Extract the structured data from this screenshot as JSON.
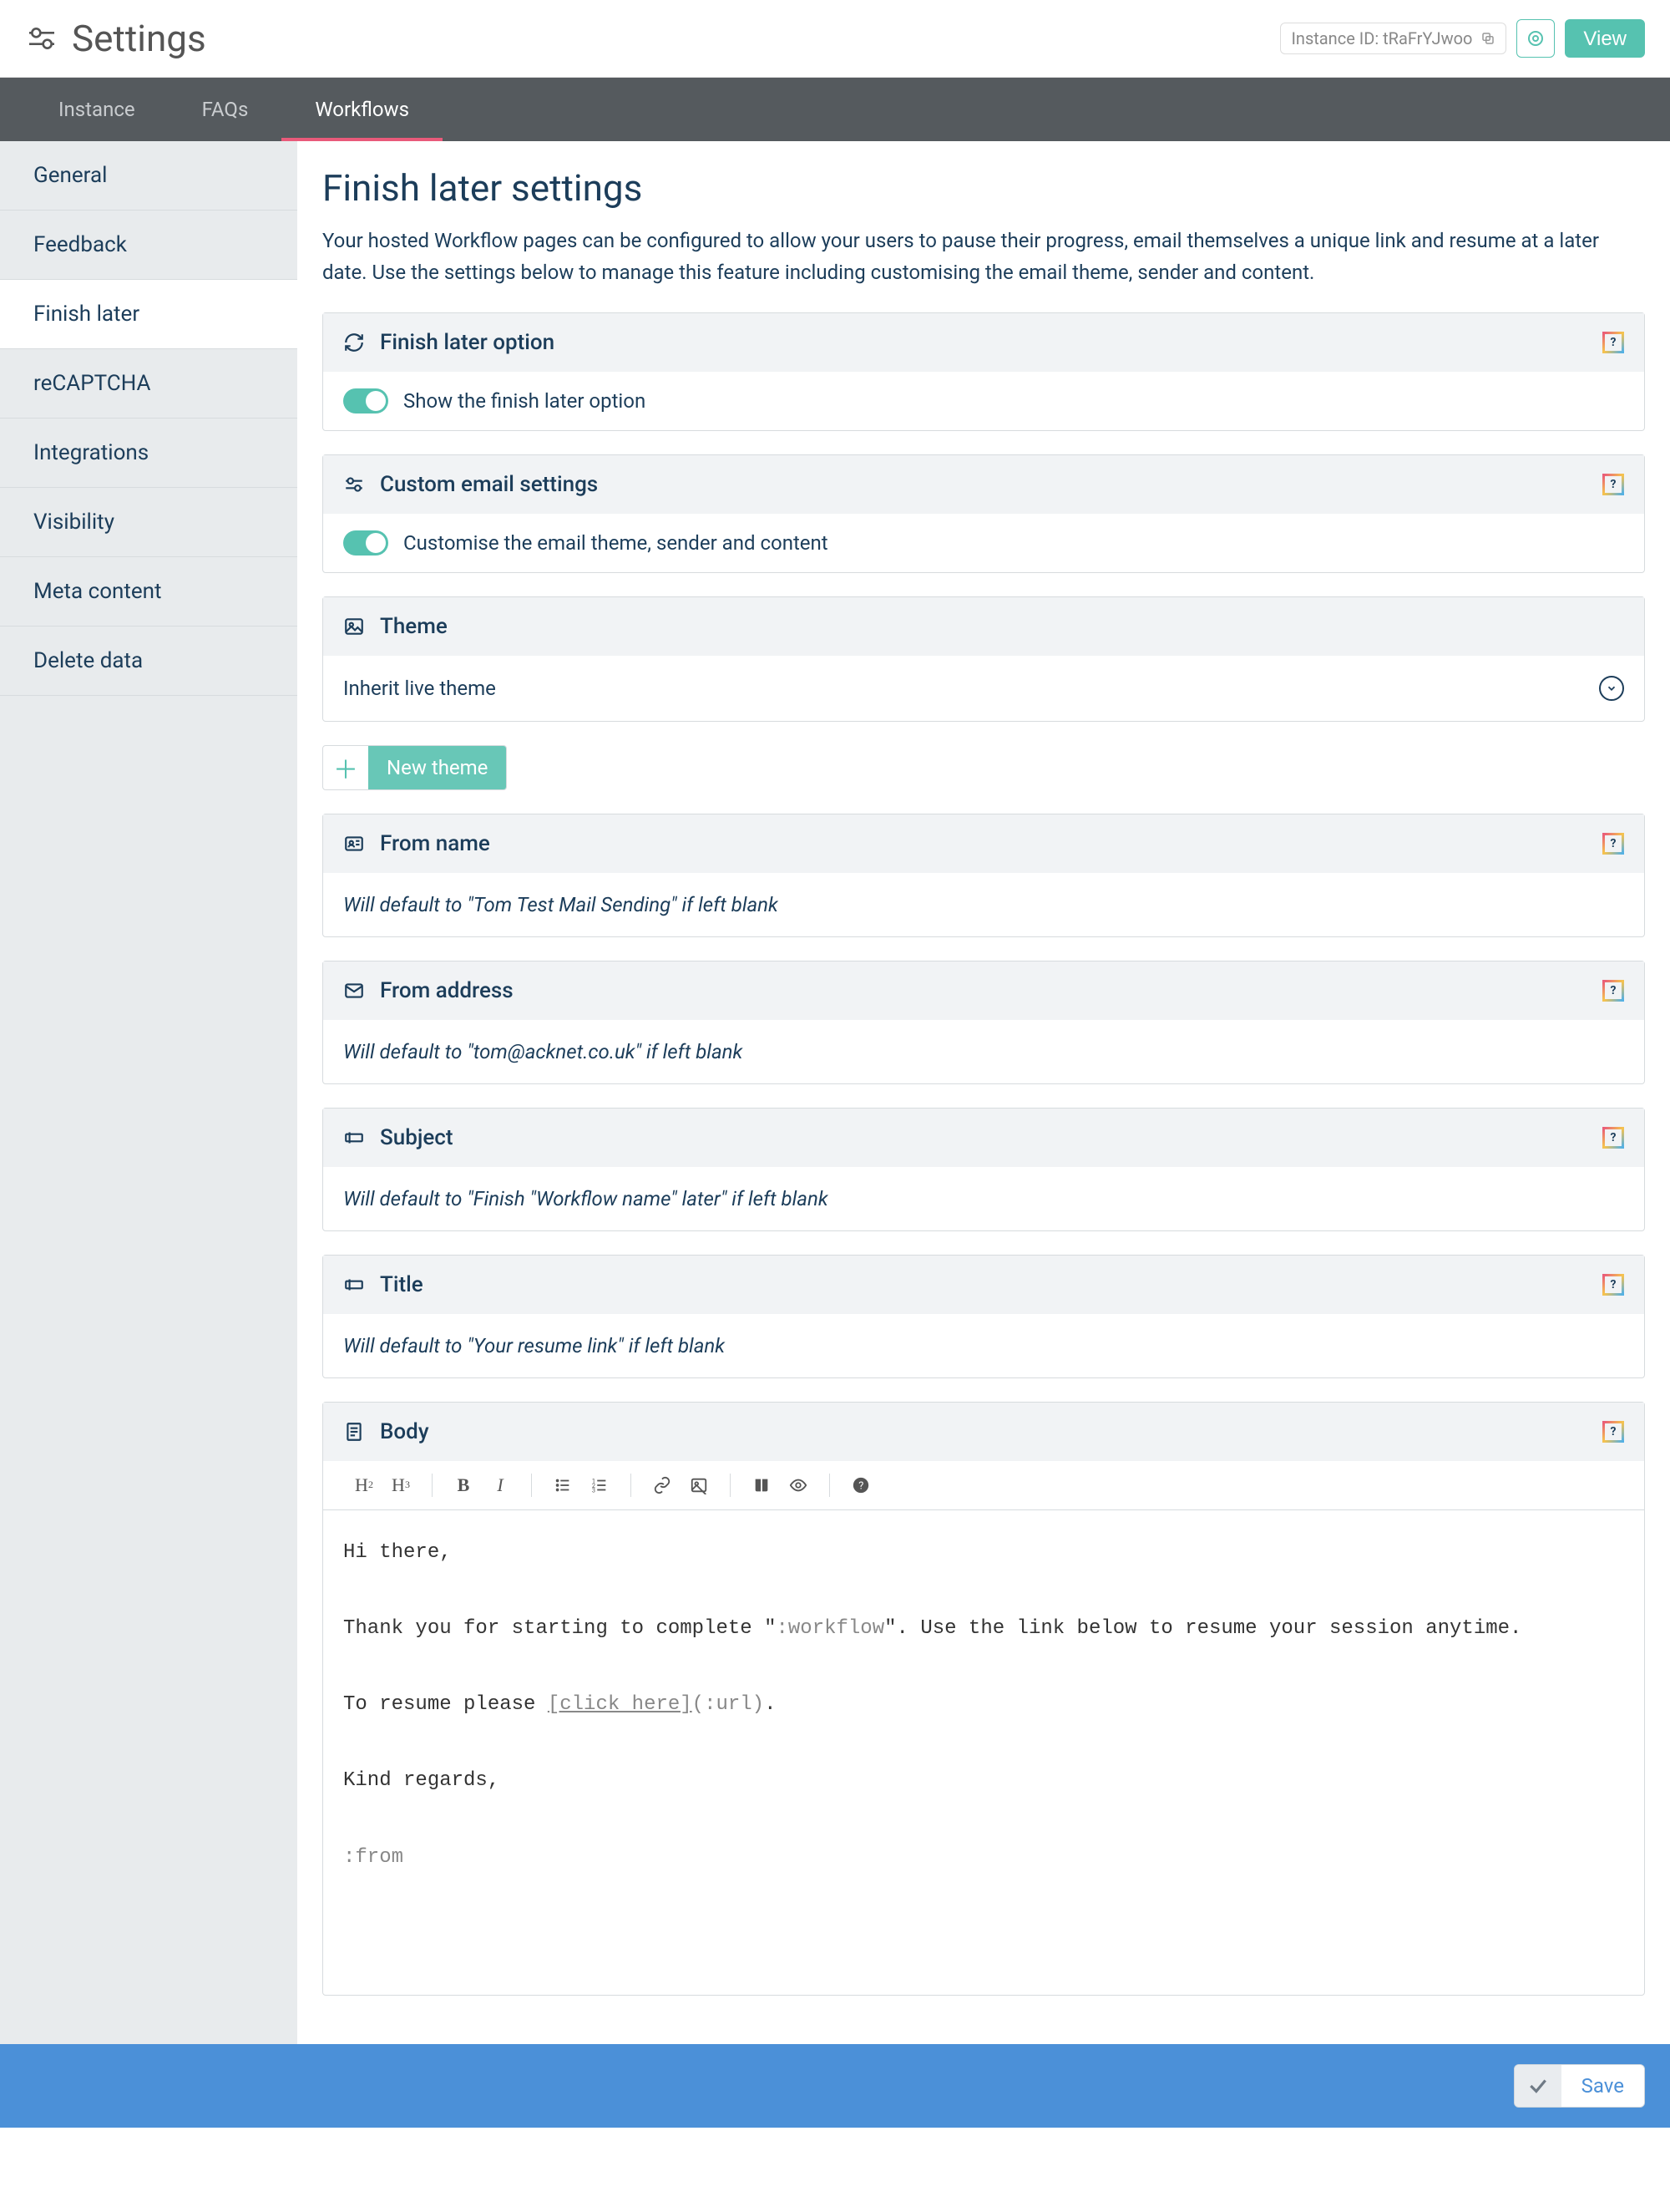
{
  "header": {
    "title": "Settings",
    "instance_label": "Instance ID: tRaFrYJwoo",
    "view_label": "View"
  },
  "tabs": [
    {
      "label": "Instance",
      "active": false
    },
    {
      "label": "FAQs",
      "active": false
    },
    {
      "label": "Workflows",
      "active": true
    }
  ],
  "sidebar": {
    "items": [
      {
        "label": "General"
      },
      {
        "label": "Feedback"
      },
      {
        "label": "Finish later",
        "active": true
      },
      {
        "label": "reCAPTCHA"
      },
      {
        "label": "Integrations"
      },
      {
        "label": "Visibility"
      },
      {
        "label": "Meta content"
      },
      {
        "label": "Delete data"
      }
    ]
  },
  "page": {
    "title": "Finish later settings",
    "description": "Your hosted Workflow pages can be configured to allow your users to pause their progress, email themselves a unique link and resume at a later date. Use the settings below to manage this feature including customising the email theme, sender and content."
  },
  "panels": {
    "finish_later_option": {
      "title": "Finish later option",
      "toggle_label": "Show the finish later option"
    },
    "custom_email": {
      "title": "Custom email settings",
      "toggle_label": "Customise the email theme, sender and content"
    },
    "theme": {
      "title": "Theme",
      "selected": "Inherit live theme",
      "new_theme_label": "New theme"
    },
    "from_name": {
      "title": "From name",
      "placeholder": "Will default to \"Tom Test Mail Sending\" if left blank"
    },
    "from_address": {
      "title": "From address",
      "placeholder": "Will default to \"tom@acknet.co.uk\" if left blank"
    },
    "subject": {
      "title": "Subject",
      "placeholder": "Will default to \"Finish \"Workflow name\" later\" if left blank"
    },
    "title_field": {
      "title": "Title",
      "placeholder": "Will default to \"Your resume link\" if left blank"
    },
    "body": {
      "title": "Body",
      "line1": "Hi there,",
      "line2a": "Thank you for starting to complete \"",
      "line2b": ":workflow",
      "line2c": "\". Use the link below to resume your session anytime.",
      "line3a": "To resume please ",
      "line3b": "[click here]",
      "line3c": "(:url)",
      "line3d": ".",
      "line4": "Kind regards,",
      "line5": ":from"
    }
  },
  "footer": {
    "save_label": "Save"
  },
  "help_badge_text": "?"
}
